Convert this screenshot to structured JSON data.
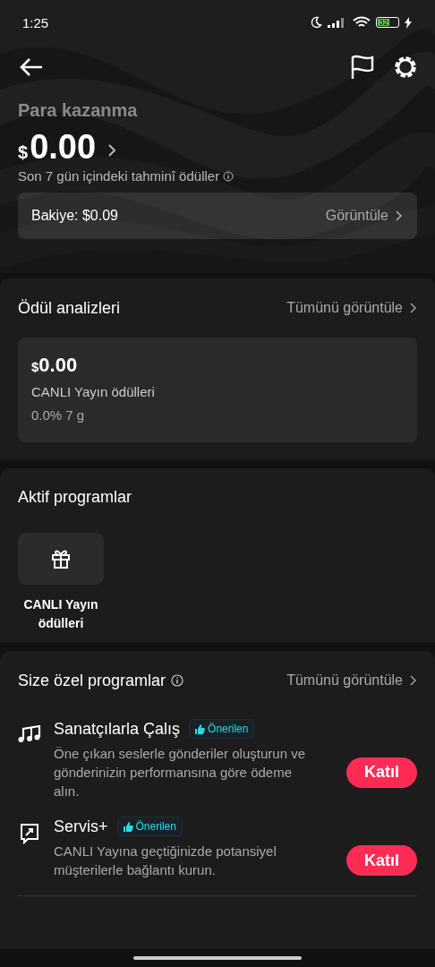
{
  "status_bar": {
    "time": "1:25",
    "battery": "32"
  },
  "header": {
    "title": "Para kazanma",
    "currency": "$",
    "amount": "0.00",
    "subtitle": "Son 7 gün içindeki tahminî ödüller",
    "balance": {
      "label": "Bakiye: $0.09",
      "action": "Görüntüle"
    }
  },
  "reward_analytics": {
    "title": "Ödül analizleri",
    "view_all": "Tümünü görüntüle",
    "card": {
      "currency": "$",
      "amount": "0.00",
      "label": "CANLI Yayın ödülleri",
      "stats": "0.0% 7 g"
    }
  },
  "active_programs": {
    "title": "Aktif programlar",
    "items": [
      {
        "kind": "gift",
        "label": "CANLI Yayın ödülleri"
      }
    ]
  },
  "special_programs": {
    "title": "Size özel programlar",
    "view_all": "Tümünü görüntüle",
    "items": [
      {
        "kind": "music",
        "title": "Sanatçılarla Çalış",
        "badge": "Önerilen",
        "description": "Öne çıkan seslerle gönderiler oluşturun ve gönderinizin performansına göre ödeme alın.",
        "button": "Katıl"
      },
      {
        "kind": "growth",
        "title": "Servis+",
        "badge": "Önerilen",
        "description": "CANLI Yayına geçtiğinizde potansiyel müşterilerle bağlantı kurun.",
        "button": "Katıl"
      }
    ]
  }
}
